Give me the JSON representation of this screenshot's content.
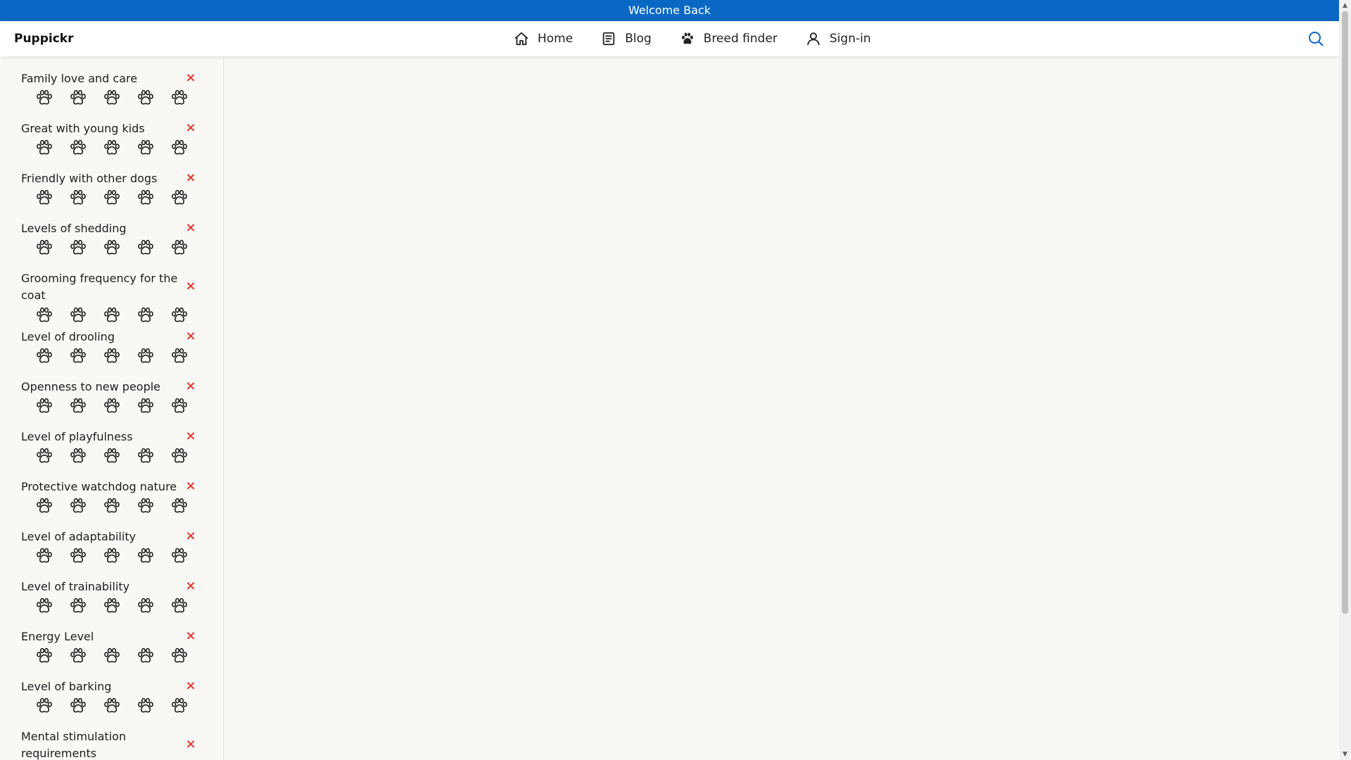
{
  "welcome": {
    "text": "Welcome Back"
  },
  "brand": {
    "name": "Puppickr"
  },
  "nav": {
    "items": [
      {
        "label": "Home",
        "icon": "home-icon"
      },
      {
        "label": "Blog",
        "icon": "blog-icon"
      },
      {
        "label": "Breed finder",
        "icon": "paw-icon"
      },
      {
        "label": "Sign-in",
        "icon": "user-icon"
      }
    ],
    "search_icon": "search-icon"
  },
  "filters": [
    {
      "label": "Family love and care",
      "rating": 0
    },
    {
      "label": "Great with young kids",
      "rating": 0
    },
    {
      "label": "Friendly with other dogs",
      "rating": 0
    },
    {
      "label": "Levels of shedding",
      "rating": 0
    },
    {
      "label": "Grooming frequency for the coat",
      "rating": 0
    },
    {
      "label": "Level of drooling",
      "rating": 0
    },
    {
      "label": "Openness to new people",
      "rating": 0
    },
    {
      "label": "Level of playfulness",
      "rating": 0
    },
    {
      "label": "Protective watchdog nature",
      "rating": 0
    },
    {
      "label": "Level of adaptability",
      "rating": 0
    },
    {
      "label": "Level of trainability",
      "rating": 0
    },
    {
      "label": "Energy Level",
      "rating": 0
    },
    {
      "label": "Level of barking",
      "rating": 0
    },
    {
      "label": "Mental stimulation requirements",
      "rating": 0
    }
  ],
  "paw_scale": 5,
  "remove_glyph": "×",
  "colors": {
    "welcome_bar": "#0a68c4",
    "remove": "#e53935",
    "search": "#0a68c4",
    "background": "#f9f8f5"
  }
}
